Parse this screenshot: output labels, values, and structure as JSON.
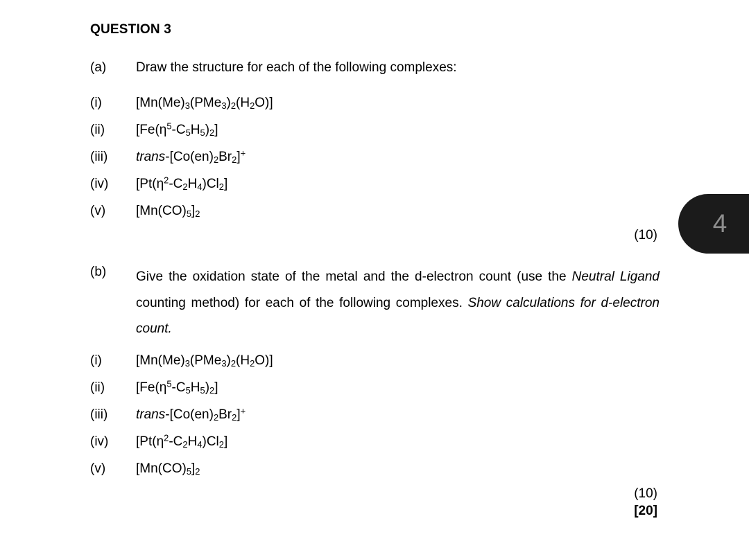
{
  "document": {
    "heading": "QUESTION 3",
    "page_tab": {
      "number": "4",
      "background_color": "#1b1b1b",
      "text_color": "#8e8e8e"
    }
  },
  "part_a": {
    "marker": "(a)",
    "prompt": "Draw the structure for each of the following complexes:",
    "marks": "(10)",
    "items": [
      {
        "marker": "(i)",
        "formula_plain": "[Mn(Me)3(PMe3)2(H2O)]",
        "segments": [
          {
            "t": "[Mn(Me)",
            "k": "n"
          },
          {
            "t": "3",
            "k": "sub"
          },
          {
            "t": "(PMe",
            "k": "n"
          },
          {
            "t": "3",
            "k": "sub"
          },
          {
            "t": ")",
            "k": "n"
          },
          {
            "t": "2",
            "k": "sub"
          },
          {
            "t": "(H",
            "k": "n"
          },
          {
            "t": "2",
            "k": "sub"
          },
          {
            "t": "O)]",
            "k": "n"
          }
        ]
      },
      {
        "marker": "(ii)",
        "formula_plain": "[Fe(η5-C5H5)2]",
        "segments": [
          {
            "t": "[Fe(",
            "k": "n"
          },
          {
            "t": "η",
            "k": "n"
          },
          {
            "t": "5",
            "k": "sup"
          },
          {
            "t": "-C",
            "k": "n"
          },
          {
            "t": "5",
            "k": "sub"
          },
          {
            "t": "H",
            "k": "n"
          },
          {
            "t": "5",
            "k": "sub"
          },
          {
            "t": ")",
            "k": "n"
          },
          {
            "t": "2",
            "k": "sub"
          },
          {
            "t": "]",
            "k": "n"
          }
        ]
      },
      {
        "marker": "(iii)",
        "formula_plain": "trans-[Co(en)2Br2]+",
        "segments": [
          {
            "t": "trans",
            "k": "ital"
          },
          {
            "t": "-[Co(en)",
            "k": "n"
          },
          {
            "t": "2",
            "k": "sub"
          },
          {
            "t": "Br",
            "k": "n"
          },
          {
            "t": "2",
            "k": "sub"
          },
          {
            "t": "]",
            "k": "n"
          },
          {
            "t": "+",
            "k": "sup"
          }
        ]
      },
      {
        "marker": "(iv)",
        "formula_plain": "[Pt(η2-C2H4)Cl2]",
        "segments": [
          {
            "t": "[Pt(",
            "k": "n"
          },
          {
            "t": "η",
            "k": "n"
          },
          {
            "t": "2",
            "k": "sup"
          },
          {
            "t": "-C",
            "k": "n"
          },
          {
            "t": "2",
            "k": "sub"
          },
          {
            "t": "H",
            "k": "n"
          },
          {
            "t": "4",
            "k": "sub"
          },
          {
            "t": ")Cl",
            "k": "n"
          },
          {
            "t": "2",
            "k": "sub"
          },
          {
            "t": "]",
            "k": "n"
          }
        ]
      },
      {
        "marker": "(v)",
        "formula_plain": "[Mn(CO)5]2",
        "segments": [
          {
            "t": "[Mn(CO)",
            "k": "n"
          },
          {
            "t": "5",
            "k": "sub"
          },
          {
            "t": "]",
            "k": "n"
          },
          {
            "t": "2",
            "k": "sub"
          }
        ]
      }
    ]
  },
  "part_b": {
    "marker": "(b)",
    "prompt_segments": [
      {
        "t": "Give the oxidation state of the metal and the d-electron count (use the ",
        "k": "n"
      },
      {
        "t": "Neutral Ligand",
        "k": "ital"
      },
      {
        "t": " counting method) for each of the following complexes. ",
        "k": "n"
      },
      {
        "t": "Show calculations for d-electron count.",
        "k": "ital"
      }
    ],
    "prompt_plain": "Give the oxidation state of the metal and the d-electron count (use the Neutral Ligand counting method) for each of the following complexes. Show calculations for d-electron count.",
    "marks": "(10)",
    "items": [
      {
        "marker": "(i)",
        "formula_plain": "[Mn(Me)3(PMe3)2(H2O)]",
        "segments": [
          {
            "t": "[Mn(Me)",
            "k": "n"
          },
          {
            "t": "3",
            "k": "sub"
          },
          {
            "t": "(PMe",
            "k": "n"
          },
          {
            "t": "3",
            "k": "sub"
          },
          {
            "t": ")",
            "k": "n"
          },
          {
            "t": "2",
            "k": "sub"
          },
          {
            "t": "(H",
            "k": "n"
          },
          {
            "t": "2",
            "k": "sub"
          },
          {
            "t": "O)]",
            "k": "n"
          }
        ]
      },
      {
        "marker": "(ii)",
        "formula_plain": "[Fe(η5-C5H5)2]",
        "segments": [
          {
            "t": "[Fe(",
            "k": "n"
          },
          {
            "t": "η",
            "k": "n"
          },
          {
            "t": "5",
            "k": "sup"
          },
          {
            "t": "-C",
            "k": "n"
          },
          {
            "t": "5",
            "k": "sub"
          },
          {
            "t": "H",
            "k": "n"
          },
          {
            "t": "5",
            "k": "sub"
          },
          {
            "t": ")",
            "k": "n"
          },
          {
            "t": "2",
            "k": "sub"
          },
          {
            "t": "]",
            "k": "n"
          }
        ]
      },
      {
        "marker": "(iii)",
        "formula_plain": "trans-[Co(en)2Br2]+",
        "segments": [
          {
            "t": "trans",
            "k": "ital"
          },
          {
            "t": "-[Co(en)",
            "k": "n"
          },
          {
            "t": "2",
            "k": "sub"
          },
          {
            "t": "Br",
            "k": "n"
          },
          {
            "t": "2",
            "k": "sub"
          },
          {
            "t": "]",
            "k": "n"
          },
          {
            "t": "+",
            "k": "sup"
          }
        ]
      },
      {
        "marker": "(iv)",
        "formula_plain": "[Pt(η2-C2H4)Cl2]",
        "segments": [
          {
            "t": "[Pt(",
            "k": "n"
          },
          {
            "t": "η",
            "k": "n"
          },
          {
            "t": "2",
            "k": "sup"
          },
          {
            "t": "-C",
            "k": "n"
          },
          {
            "t": "2",
            "k": "sub"
          },
          {
            "t": "H",
            "k": "n"
          },
          {
            "t": "4",
            "k": "sub"
          },
          {
            "t": ")Cl",
            "k": "n"
          },
          {
            "t": "2",
            "k": "sub"
          },
          {
            "t": "]",
            "k": "n"
          }
        ]
      },
      {
        "marker": "(v)",
        "formula_plain": "[Mn(CO)5]2",
        "segments": [
          {
            "t": "[Mn(CO)",
            "k": "n"
          },
          {
            "t": "5",
            "k": "sub"
          },
          {
            "t": "]",
            "k": "n"
          },
          {
            "t": "2",
            "k": "sub"
          }
        ]
      }
    ]
  },
  "total_marks": "[20]"
}
